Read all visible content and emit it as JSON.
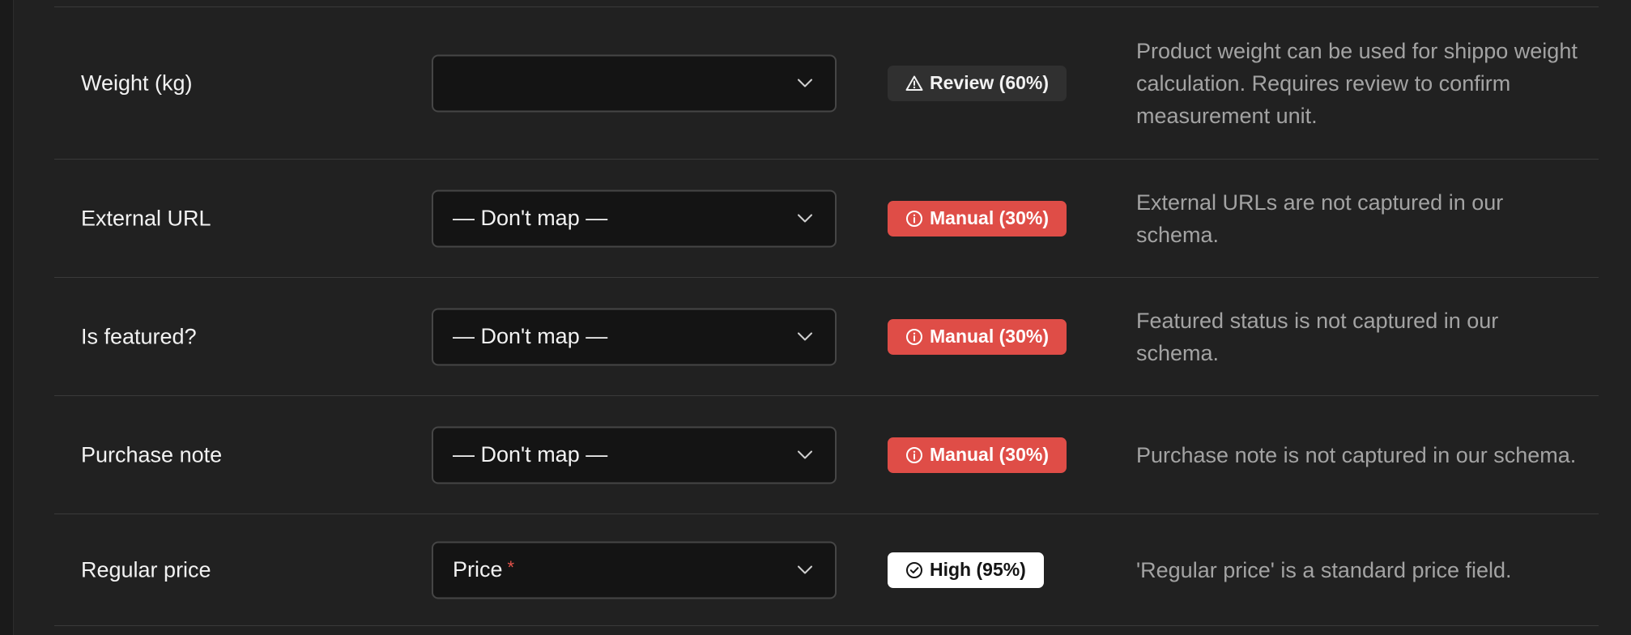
{
  "rows": [
    {
      "field": "Weight (kg)",
      "mapping": "",
      "required": false,
      "confidence": {
        "level": "review",
        "label": "Review (60%)",
        "icon": "warning-icon"
      },
      "reason": "Product weight can be used for shippo weight calculation. Requires review to confirm measurement unit."
    },
    {
      "field": "External URL",
      "mapping": "— Don't map —",
      "required": false,
      "confidence": {
        "level": "manual",
        "label": "Manual (30%)",
        "icon": "info-circle-icon"
      },
      "reason": "External URLs are not captured in our schema."
    },
    {
      "field": "Is featured?",
      "mapping": "— Don't map —",
      "required": false,
      "confidence": {
        "level": "manual",
        "label": "Manual (30%)",
        "icon": "info-circle-icon"
      },
      "reason": "Featured status is not captured in our schema."
    },
    {
      "field": "Purchase note",
      "mapping": "— Don't map —",
      "required": false,
      "confidence": {
        "level": "manual",
        "label": "Manual (30%)",
        "icon": "info-circle-icon"
      },
      "reason": "Purchase note is not captured in our schema."
    },
    {
      "field": "Regular price",
      "mapping": "Price",
      "required": true,
      "required_marker": "*",
      "confidence": {
        "level": "high",
        "label": "High (95%)",
        "icon": "check-circle-icon"
      },
      "reason": "'Regular price' is a standard price field."
    }
  ],
  "colors": {
    "manual": "#df4d47",
    "review": "#303030",
    "high": "#ffffff",
    "required": "#e5534b"
  }
}
